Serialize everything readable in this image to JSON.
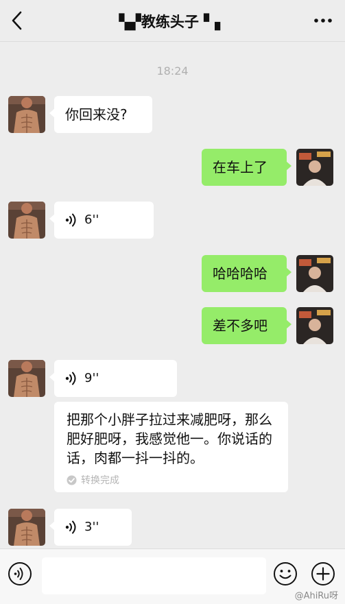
{
  "header": {
    "title": "▚▞教练头子 ▘▖",
    "back_icon": "back-chevron-icon",
    "more_icon": "more-dots-icon"
  },
  "chat": {
    "timestamp": "18:24",
    "messages": [
      {
        "side": "in",
        "type": "text",
        "text": "你回来没?"
      },
      {
        "side": "out",
        "type": "text",
        "text": "在车上了"
      },
      {
        "side": "in",
        "type": "voice",
        "duration": "6''"
      },
      {
        "side": "out",
        "type": "text",
        "text": "哈哈哈哈"
      },
      {
        "side": "out",
        "type": "text",
        "text": "差不多吧"
      },
      {
        "side": "in",
        "type": "voice",
        "duration": "9''"
      },
      {
        "side": "in",
        "type": "transcript",
        "text": "把那个小胖子拉过来减肥呀，那么肥好肥呀，我感觉他一。你说话的话，肉都一抖一抖的。",
        "status": "转换完成"
      },
      {
        "side": "in",
        "type": "voice",
        "duration": "3''"
      }
    ]
  },
  "composer": {
    "voice_icon": "voice-mode-icon",
    "emoji_icon": "emoji-icon",
    "plus_icon": "plus-icon",
    "input_value": ""
  },
  "watermark": "@AhiRu呀",
  "colors": {
    "background": "#ededed",
    "outgoing_bubble": "#95ec69",
    "incoming_bubble": "#ffffff"
  }
}
